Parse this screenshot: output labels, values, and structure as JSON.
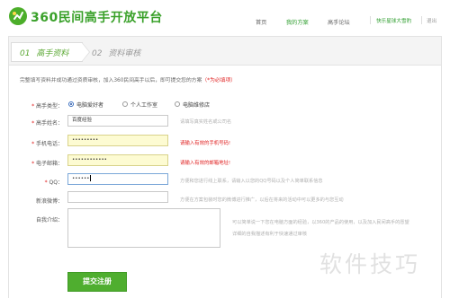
{
  "header": {
    "logo_text": "360民间高手开放平台",
    "nav": [
      "首页",
      "我的方案",
      "高手论坛"
    ],
    "active_nav": "我的方案",
    "top_links": [
      "快乐星球大雪豹",
      "退出"
    ]
  },
  "steps": [
    {
      "num": "01",
      "label": "高手资料"
    },
    {
      "num": "02",
      "label": "资料审核"
    }
  ],
  "intro": {
    "text": "完整填写资料并成功通过资质审核，加入360民间高手以后，即可提交您的方案",
    "required_note": "（*为必填项）"
  },
  "form": {
    "type_label": "高手类型：",
    "type_options": [
      "电脑爱好者",
      "个人工作室",
      "电脑维修店"
    ],
    "selected_type": "电脑爱好者",
    "name_label": "高手姓名：",
    "name_value": "百度经验",
    "name_hint": "请填写真实姓名或公司名",
    "phone_label": "手机电话：",
    "phone_value": "•••••••••",
    "phone_error": "请输入有效的手机号码!",
    "email_label": "电子邮箱：",
    "email_value": "••••••••••••",
    "email_error": "请输入有效的邮箱地址!",
    "qq_label": "QQ：",
    "qq_value": "••••••",
    "qq_hint": "方便和您进行线上联系，请输入以您的QQ号码以及个人简单联系信息",
    "weibo_label": "新浪微博：",
    "weibo_value": "",
    "weibo_hint": "方便在方案包装时您的微博进行推广，以后在将来的活动中可以更多的与您互动",
    "intro_label": "自我介绍：",
    "intro_value": "",
    "intro_hint_1": "可以简单说一下您在电脑方面的经验，以360的产品的使用，以及加入民间高手的愿望",
    "intro_hint_2": "详细的自我描述有利于快速通过审核"
  },
  "submit_label": "提交注册",
  "watermark": "软件技巧",
  "colors": {
    "brand_green": "#4fae2f",
    "error_red": "#e02020",
    "error_field_bg": "#fdfbd2"
  }
}
